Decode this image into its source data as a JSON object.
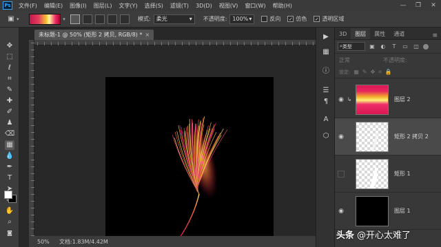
{
  "app": {
    "logo": "Ps"
  },
  "menu": [
    "文件(F)",
    "编辑(E)",
    "图像(I)",
    "图层(L)",
    "文字(Y)",
    "选择(S)",
    "滤镜(T)",
    "3D(D)",
    "视图(V)",
    "窗口(W)",
    "帮助(H)"
  ],
  "window_controls": [
    "—",
    "❐",
    "✕"
  ],
  "options": {
    "mode_label": "模式:",
    "mode_value": "柔光",
    "opacity_label": "不透明度:",
    "opacity_value": "100%",
    "reverse_label": "反向",
    "dither_label": "仿色",
    "transparency_label": "透明区域",
    "reverse_checked": false,
    "dither_checked": true,
    "transparency_checked": true
  },
  "document": {
    "tab_title": "未标题-1 @ 50% (矩形 2 拷贝, RGB/8) *",
    "close": "×",
    "zoom": "50%",
    "doc_info": "文档:1.83M/4.42M"
  },
  "panel": {
    "tabs": [
      "3D",
      "图层",
      "属性",
      "通道"
    ],
    "active_tab": "图层",
    "filter_label": "类型",
    "blend_mode": "正常",
    "opacity_label": "不透明度:",
    "lock_label": "锁定:",
    "layers": [
      {
        "name": "图层 2",
        "thumb": "gradient",
        "visible": true,
        "clipped": true,
        "selected": false
      },
      {
        "name": "矩形 2 拷贝 2",
        "thumb": "checker",
        "visible": true,
        "clipped": false,
        "selected": true
      },
      {
        "name": "矩形 1",
        "thumb": "checker",
        "visible": false,
        "clipped": false,
        "selected": false
      },
      {
        "name": "图层 1",
        "thumb": "black",
        "visible": true,
        "clipped": false,
        "selected": false
      }
    ]
  },
  "watermark": {
    "platform": "头条",
    "handle": "@开心太难了"
  },
  "colors": {
    "accent": "#31a8ff",
    "gradient_start": "#c3184b",
    "gradient_mid": "#f6c331",
    "gradient_end": "#b2002d"
  }
}
